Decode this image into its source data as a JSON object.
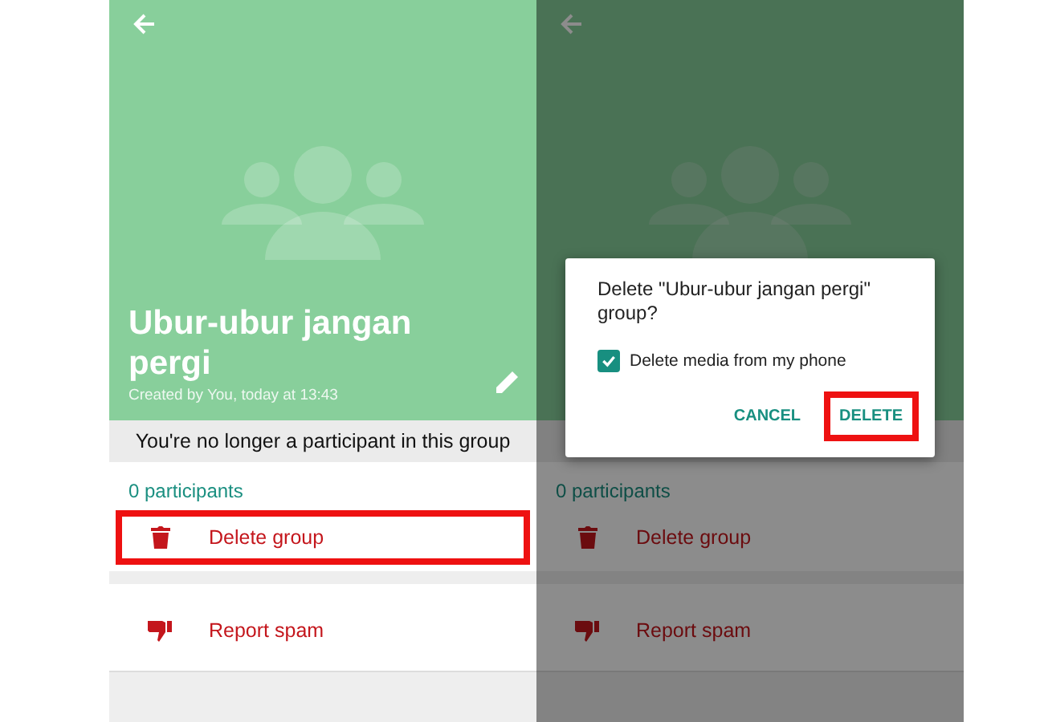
{
  "screens": [
    {
      "dimmed": false,
      "header": {
        "title": "Ubur-ubur jangan pergi",
        "subtitle": "Created by You, today at 13:43"
      },
      "notice": "You're no longer a participant in this group",
      "participants": "0 participants",
      "actions": [
        {
          "kind": "delete",
          "label": "Delete group",
          "highlighted": true
        },
        {
          "kind": "spam",
          "label": "Report spam",
          "highlighted": false
        }
      ]
    },
    {
      "dimmed": true,
      "participants": "0 participants",
      "actions": [
        {
          "kind": "delete",
          "label": "Delete group",
          "highlighted": false
        },
        {
          "kind": "spam",
          "label": "Report spam",
          "highlighted": false
        }
      ],
      "dialog": {
        "message": "Delete \"Ubur-ubur jangan pergi\" group?",
        "checkbox": {
          "label": "Delete media from my phone",
          "checked": true
        },
        "buttons": [
          {
            "label": "CANCEL",
            "highlighted": false
          },
          {
            "label": "DELETE",
            "highlighted": true
          }
        ]
      }
    }
  ]
}
